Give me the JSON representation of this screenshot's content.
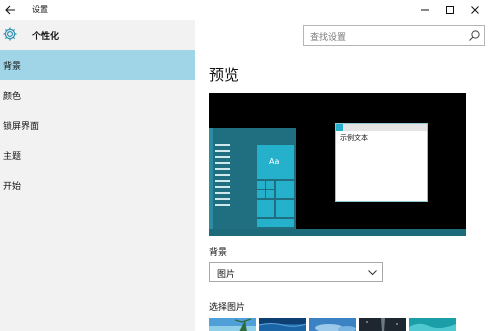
{
  "window": {
    "title": "设置",
    "back_icon": "arrow-left-icon",
    "controls": [
      "minimize-icon",
      "maximize-icon",
      "close-icon"
    ]
  },
  "sidebar": {
    "header_icon": "gear-icon",
    "title": "个性化",
    "items": [
      {
        "label": "背景",
        "active": true
      },
      {
        "label": "颜色",
        "active": false
      },
      {
        "label": "锁屏界面",
        "active": false
      },
      {
        "label": "主题",
        "active": false
      },
      {
        "label": "开始",
        "active": false
      }
    ]
  },
  "search": {
    "placeholder": "查找设置",
    "icon": "search-icon"
  },
  "main": {
    "preview_heading": "预览",
    "preview": {
      "tile_label": "Aa",
      "window_text": "示例文本"
    },
    "background_label": "背景",
    "background_value": "图片",
    "choose_picture_label": "选择图片",
    "thumbnails": [
      {
        "name": "beach"
      },
      {
        "name": "lake"
      },
      {
        "name": "sky"
      },
      {
        "name": "night"
      },
      {
        "name": "wave"
      }
    ]
  },
  "colors": {
    "accent": "#25b0cb",
    "active_nav": "#9fd5e6",
    "sidebar_bg": "#f2f2f2",
    "preview_bg": "#000000"
  }
}
